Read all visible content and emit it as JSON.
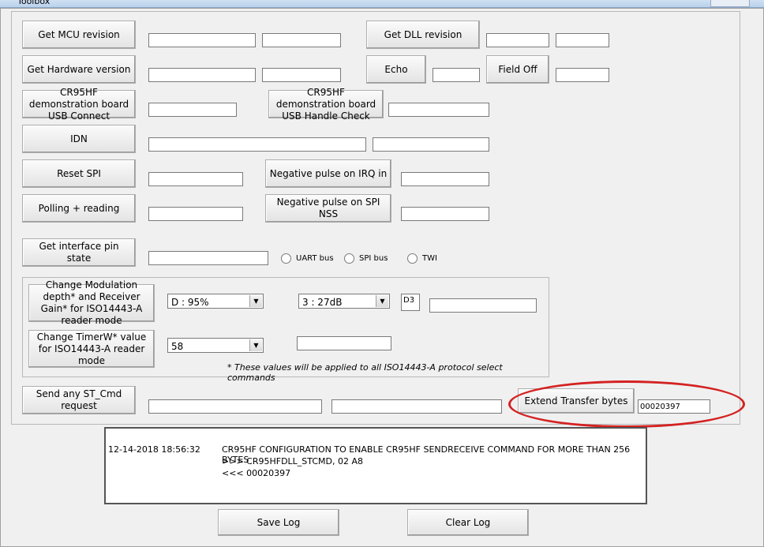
{
  "window": {
    "title": "Toolbox"
  },
  "buttons": {
    "get_mcu_revision": "Get MCU revision",
    "get_hardware_version": "Get Hardware version",
    "usb_connect": "CR95HF demonstration board USB Connect",
    "idn": "IDN",
    "reset_spi": "Reset SPI",
    "polling_reading": "Polling + reading",
    "get_interface_pin_state": "Get interface pin state",
    "get_dll_revision": "Get DLL revision",
    "echo": "Echo",
    "field_off": "Field Off",
    "usb_handle_check": "CR95HF demonstration board USB Handle Check",
    "negative_pulse_irq": "Negative pulse on IRQ in",
    "negative_pulse_spi_nss": "Negative pulse on SPI NSS",
    "change_modulation": "Change Modulation depth* and Receiver Gain* for ISO14443-A reader mode",
    "change_timerw": "Change TimerW* value for ISO14443-A reader mode",
    "send_st_cmd": "Send any ST_Cmd request",
    "extend_transfer_bytes": "Extend Transfer bytes",
    "save_log": "Save Log",
    "clear_log": "Clear Log"
  },
  "radios": {
    "uart": "UART bus",
    "spi": "SPI bus",
    "twi": "TWI"
  },
  "selects": {
    "modulation_depth": "D : 95%",
    "receiver_gain": "3 : 27dB",
    "timerw": "58"
  },
  "fields": {
    "modulation_code": "D3",
    "extend_transfer_value": "00020397"
  },
  "note": "* These values will be applied to all ISO14443-A protocol select commands",
  "log": {
    "timestamp": "12-14-2018 18:56:32",
    "lines": [
      "CR95HF CONFIGURATION TO ENABLE CR95HF SENDRECEIVE COMMAND FOR MORE THAN 256 BYTES",
      ">>> CR95HFDLL_STCMD, 02 A8",
      "<<< 00020397"
    ]
  },
  "colors": {
    "annotation_ellipse": "#d42222",
    "window_bg": "#f0f0f0"
  }
}
